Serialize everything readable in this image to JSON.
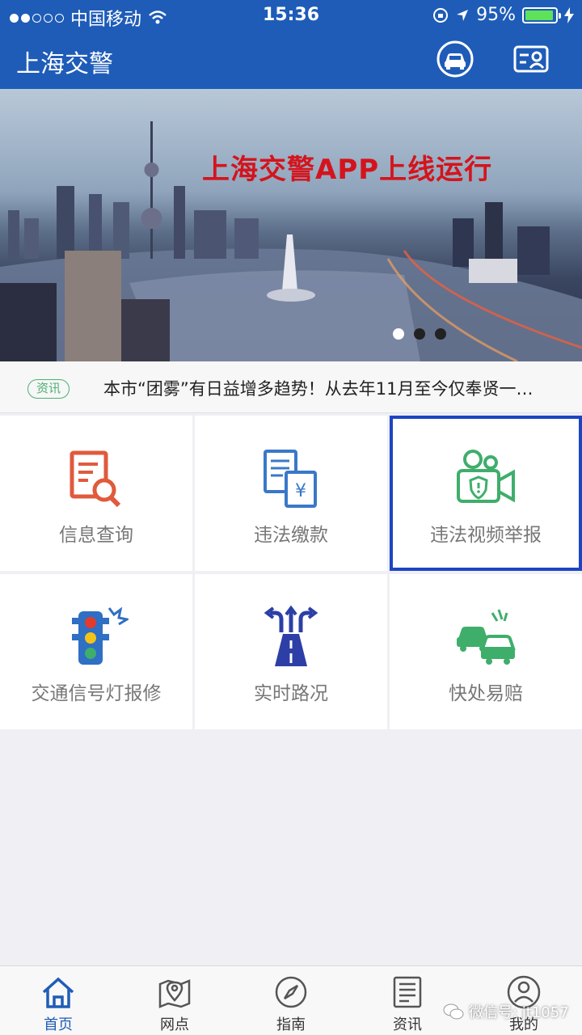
{
  "status_bar": {
    "carrier": "中国移动",
    "time": "15:36",
    "battery": "95%",
    "battery_level": 0.95
  },
  "nav": {
    "title": "上海交警"
  },
  "banner": {
    "headline": "上海交警APP上线运行",
    "slide_count": 3,
    "active_slide": 1
  },
  "news": {
    "tag": "资讯",
    "text": "本市“团雾”有日益增多趋势！从去年11月至今仅奉贤一…"
  },
  "services": [
    {
      "label": "信息查询",
      "icon": "document-search-icon"
    },
    {
      "label": "违法缴款",
      "icon": "bill-payment-icon"
    },
    {
      "label": "违法视频举报",
      "icon": "video-camera-report-icon",
      "highlighted": true
    },
    {
      "label": "交通信号灯报修",
      "icon": "traffic-light-icon"
    },
    {
      "label": "实时路况",
      "icon": "road-condition-icon"
    },
    {
      "label": "快处易赔",
      "icon": "car-accident-icon"
    }
  ],
  "tabs": [
    {
      "label": "首页",
      "icon": "home-icon",
      "active": true
    },
    {
      "label": "网点",
      "icon": "map-pin-icon"
    },
    {
      "label": "指南",
      "icon": "compass-icon"
    },
    {
      "label": "资讯",
      "icon": "news-icon"
    },
    {
      "label": "我的",
      "icon": "user-icon"
    }
  ],
  "watermark": "微信号: jt1057",
  "colors": {
    "brand_blue": "#1e5cb8",
    "accent_green": "#4caf73",
    "headline_red": "#d4141c",
    "highlight_border": "#1d45c2"
  }
}
